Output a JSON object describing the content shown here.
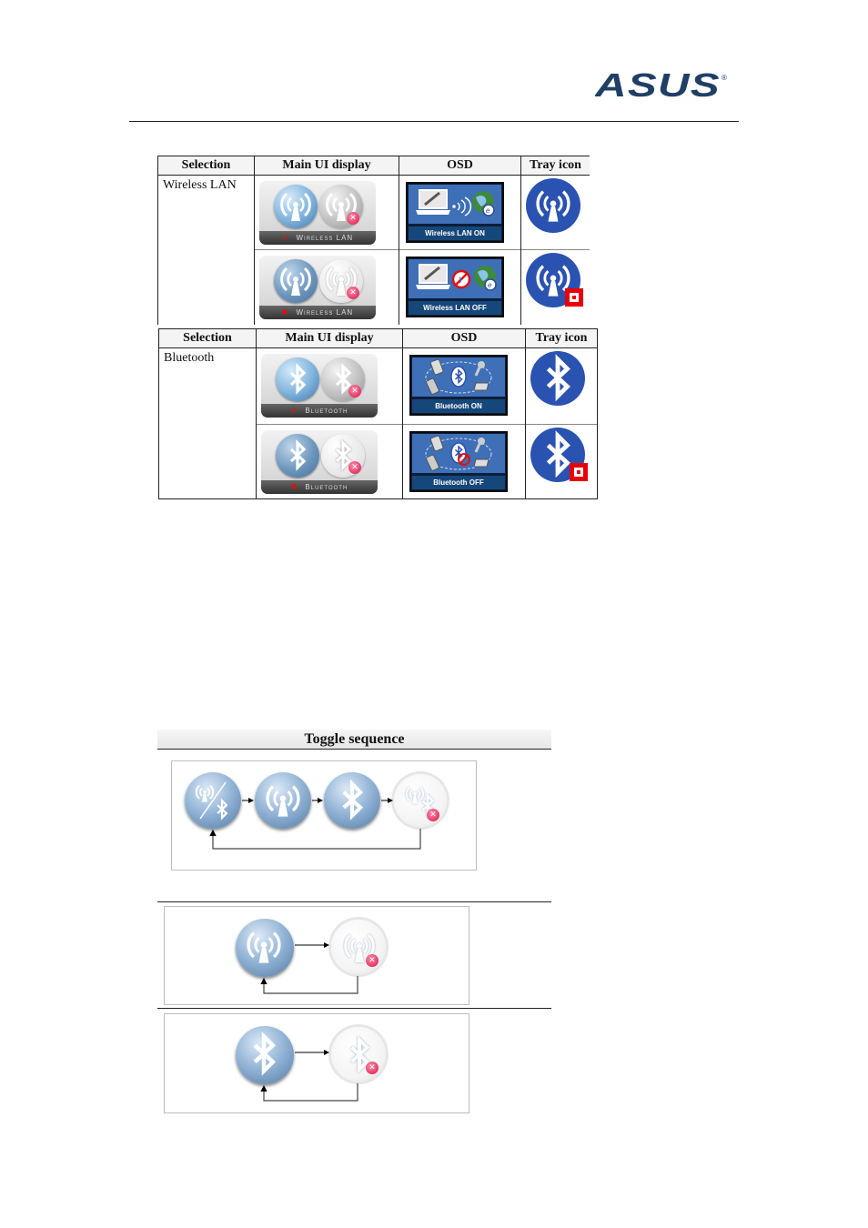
{
  "header": {
    "logo_text": "ASUS",
    "logo_mark": "®",
    "brand_color": "#1f3f66"
  },
  "wlan_table": {
    "headers": [
      "Selection",
      "Main UI display",
      "OSD",
      "Tray icon"
    ],
    "selection": "Wireless LAN",
    "rows": [
      {
        "state": "on",
        "main_ui_label": "Wireless LAN",
        "main_ui_mark": "✔",
        "osd_label": "Wireless LAN ON",
        "tray_icon": "wlan-tray-icon"
      },
      {
        "state": "off",
        "main_ui_label": "Wireless LAN",
        "main_ui_mark": "✖",
        "osd_label": "Wireless LAN OFF",
        "tray_icon": "wlan-tray-off-icon"
      }
    ]
  },
  "bt_table": {
    "headers": [
      "Selection",
      "Main UI display",
      "OSD",
      "Tray icon"
    ],
    "selection": "Bluetooth",
    "rows": [
      {
        "state": "on",
        "main_ui_label": "Bluetooth",
        "main_ui_mark": "✔",
        "osd_label": "Bluetooth ON",
        "tray_icon": "bluetooth-tray-icon"
      },
      {
        "state": "off",
        "main_ui_label": "Bluetooth",
        "main_ui_mark": "✖",
        "osd_label": "Bluetooth OFF",
        "tray_icon": "bluetooth-tray-off-icon"
      }
    ]
  },
  "toggle": {
    "title": "Toggle sequence",
    "sequences": [
      {
        "name": "combined",
        "steps": [
          "wlan+bluetooth on",
          "wlan on",
          "bluetooth on",
          "all off"
        ]
      },
      {
        "name": "wlan",
        "steps": [
          "wlan on",
          "wlan off"
        ]
      },
      {
        "name": "bluetooth",
        "steps": [
          "bluetooth on",
          "bluetooth off"
        ]
      }
    ]
  },
  "colors": {
    "tray_blue": "#2a52b0",
    "osd_blue": "#3e6fb7",
    "off_red": "#e8000a"
  }
}
